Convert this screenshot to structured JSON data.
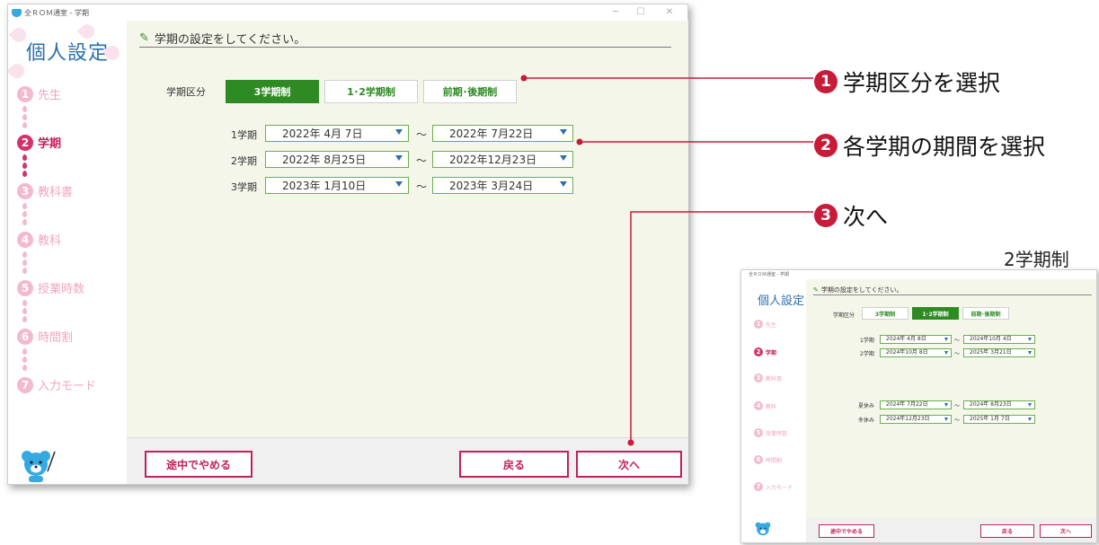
{
  "main_window": {
    "title": "全ＲＯＭ通室 - 学期",
    "sidebar": {
      "title": "個人設定",
      "steps": [
        {
          "num": "1",
          "label": "先生"
        },
        {
          "num": "2",
          "label": "学期"
        },
        {
          "num": "3",
          "label": "教科書"
        },
        {
          "num": "4",
          "label": "教科"
        },
        {
          "num": "5",
          "label": "授業時数"
        },
        {
          "num": "6",
          "label": "時間割"
        },
        {
          "num": "7",
          "label": "入力モード"
        }
      ],
      "active_step": 2
    },
    "heading": "学期の設定をしてください。",
    "term_division": {
      "label": "学期区分",
      "options": [
        "3学期制",
        "1･2学期制",
        "前期･後期制"
      ],
      "selected": "3学期制"
    },
    "terms": [
      {
        "label": "1学期",
        "start": "2022年  4月  7日",
        "end": "2022年  7月22日"
      },
      {
        "label": "2学期",
        "start": "2022年  8月25日",
        "end": "2022年12月23日"
      },
      {
        "label": "3学期",
        "start": "2023年  1月10日",
        "end": "2023年  3月24日"
      }
    ],
    "range_separator": "～",
    "footer": {
      "quit": "途中でやめる",
      "back": "戻る",
      "next": "次へ"
    }
  },
  "callouts": [
    {
      "num": "1",
      "text": "学期区分を選択"
    },
    {
      "num": "2",
      "text": "各学期の期間を選択"
    },
    {
      "num": "3",
      "text": "次へ"
    }
  ],
  "mini_caption": "2学期制",
  "mini_window": {
    "title": "全ＲＯＭ通室 - 学期",
    "sidebar_title": "個人設定",
    "steps": [
      {
        "num": "1",
        "label": "先生"
      },
      {
        "num": "2",
        "label": "学期"
      },
      {
        "num": "3",
        "label": "教科書"
      },
      {
        "num": "4",
        "label": "教科"
      },
      {
        "num": "5",
        "label": "授業時数"
      },
      {
        "num": "6",
        "label": "時間割"
      },
      {
        "num": "7",
        "label": "入力モード"
      }
    ],
    "heading": "学期の設定をしてください。",
    "division_label": "学期区分",
    "options": [
      "3学期制",
      "1･2学期制",
      "前期･後期制"
    ],
    "selected": "1･2学期制",
    "terms": [
      {
        "label": "1学期",
        "start": "2024年  4月  8日",
        "end": "2024年10月  4日"
      },
      {
        "label": "2学期",
        "start": "2024年10月  8日",
        "end": "2025年  3月21日"
      }
    ],
    "breaks": [
      {
        "label": "夏休み",
        "start": "2024年  7月22日",
        "end": "2024年  8月23日"
      },
      {
        "label": "冬休み",
        "start": "2024年12月23日",
        "end": "2025年  1月  7日"
      }
    ],
    "footer": {
      "quit": "途中でやめる",
      "back": "戻る",
      "next": "次へ"
    }
  },
  "colors": {
    "accent_green": "#2e8b24",
    "accent_red": "#c81b3a",
    "step_active": "#d2336c",
    "title_blue": "#2b6fb0"
  }
}
